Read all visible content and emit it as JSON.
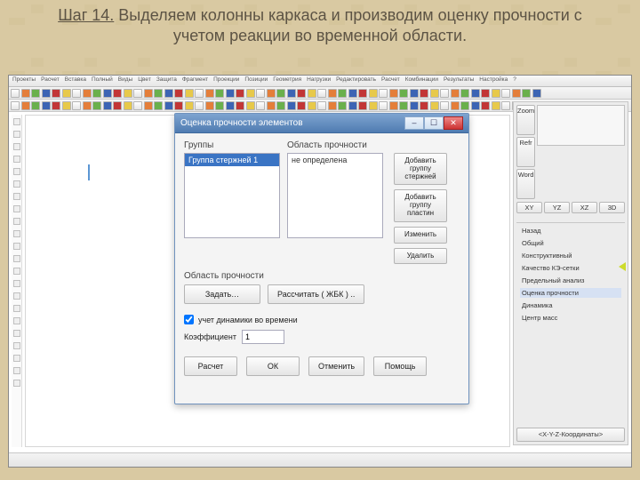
{
  "slide": {
    "step": "Шаг 14.",
    "rest": " Выделяем колонны каркаса и производим оценку прочности с учетом реакции во временной области."
  },
  "menubar": [
    "Проекты",
    "Расчет",
    "Вставка",
    "Полный",
    "Виды",
    "Цвет",
    "Защита",
    "Фрагмент",
    "Проекции",
    "Позиции",
    "Геометрия",
    "Нагрузки",
    "Редактировать",
    "Расчет",
    "Комбинации",
    "Результаты",
    "Настройка",
    "?"
  ],
  "rp": {
    "zoom": "Zoom",
    "refr": "Refr",
    "word": "Word",
    "views": [
      "XY",
      "YZ",
      "XZ",
      "3D"
    ],
    "list": [
      "Назад",
      "Общий",
      "Конструктивный",
      "Качество КЭ-сетки",
      "Предельный анализ",
      "Оценка прочности",
      "Динамика",
      "Центр масс"
    ],
    "active": "Оценка прочности",
    "coords": "<X-Y-Z-Координаты>"
  },
  "dialog": {
    "title": "Оценка прочности элементов",
    "groups_label": "Группы",
    "area_label": "Область прочности",
    "group_item": "Группа стержней 1",
    "area_item": "не определена",
    "btn_add_rods": "Добавить группу стержней",
    "btn_add_plates": "Добавить группу пластин",
    "btn_edit": "Изменить",
    "btn_delete": "Удалить",
    "area2_label": "Область прочности",
    "btn_set": "Задать…",
    "btn_calc_rc": "Рассчитать ( ЖБК ) ..",
    "chk_dyn": "учет динамики во времени",
    "chk_dyn_checked": true,
    "coef_label": "Коэффициент",
    "coef_value": "1",
    "btn_run": "Расчет",
    "btn_ok": "ОК",
    "btn_cancel": "Отменить",
    "btn_help": "Помощь"
  }
}
